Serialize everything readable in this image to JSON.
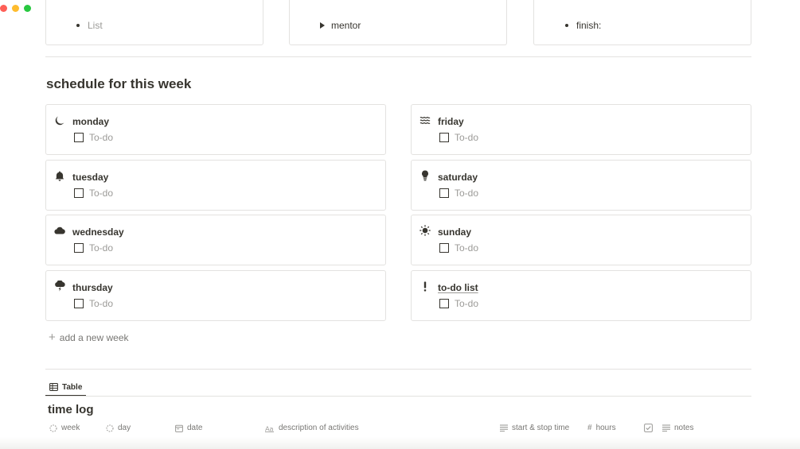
{
  "top_cards": [
    {
      "kind": "bullet",
      "text": "List",
      "muted": true
    },
    {
      "kind": "toggle",
      "text": "mentor",
      "muted": false
    },
    {
      "kind": "bullet",
      "text": "finish:",
      "muted": false
    }
  ],
  "schedule": {
    "title": "schedule for this week",
    "todo_placeholder": "To-do",
    "left": [
      {
        "label": "monday",
        "icon": "moon-icon"
      },
      {
        "label": "tuesday",
        "icon": "bell-icon"
      },
      {
        "label": "wednesday",
        "icon": "cloud-icon"
      },
      {
        "label": "thursday",
        "icon": "storm-cloud-icon"
      }
    ],
    "right": [
      {
        "label": "friday",
        "icon": "waves-icon"
      },
      {
        "label": "saturday",
        "icon": "lightbulb-icon"
      },
      {
        "label": "sunday",
        "icon": "sun-icon"
      },
      {
        "label": "to-do list",
        "icon": "exclamation-icon"
      }
    ],
    "add_week_label": "add a new week"
  },
  "database": {
    "tab_label": "Table",
    "title": "time log",
    "columns": [
      {
        "label": "week",
        "icon": "status-icon"
      },
      {
        "label": "day",
        "icon": "status-icon"
      },
      {
        "label": "date",
        "icon": "calendar-icon"
      },
      {
        "label": "description of activities",
        "icon": "text-title-icon"
      },
      {
        "label": "start & stop time",
        "icon": "text-icon"
      },
      {
        "label": "hours",
        "icon": "number-icon"
      },
      {
        "label": "",
        "icon": "checkbox-icon"
      },
      {
        "label": "notes",
        "icon": "text-icon"
      }
    ]
  }
}
